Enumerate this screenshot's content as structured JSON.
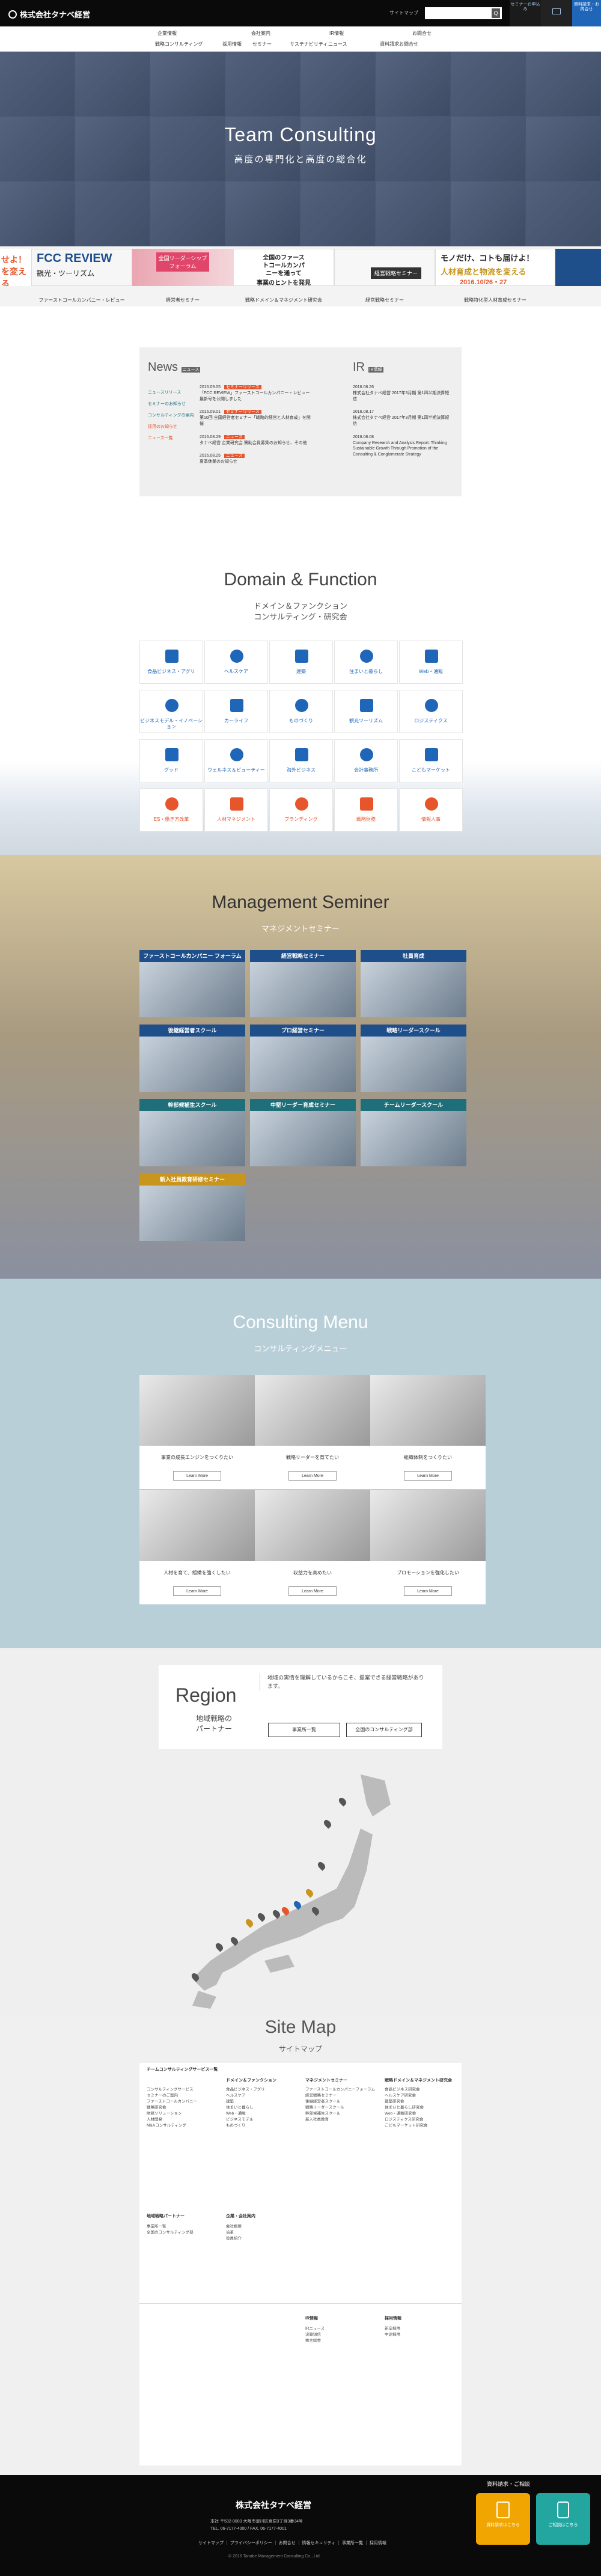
{
  "header": {
    "logo": "株式会社タナベ経営",
    "sitemap": "サイトマップ",
    "search_placeholder": "",
    "search_btn": "Q",
    "btn1": "セミナーお申込み",
    "btn2": "",
    "btn3": "資料請求・お問合せ"
  },
  "nav": {
    "col1": {
      "title": "企業情報",
      "items": [
        "戦略コンサルティング",
        "採用情報",
        "サステナビリティ"
      ]
    },
    "col2": {
      "title": "会社案内",
      "items": [
        "採用",
        "セミナー"
      ]
    },
    "col3": {
      "title": "IR情報",
      "items": [
        "ニュース",
        "ホールディングス"
      ]
    },
    "col4": {
      "title": "お問合せ",
      "items": [
        "資料請求お問合せ",
        "ダウンロード"
      ]
    }
  },
  "hero": {
    "title": "Team Consulting",
    "subtitle": "高度の専門化と高度の総合化"
  },
  "banners": [
    {
      "caption": "ファーストコールカンパニー・レビュー",
      "big": "FCC REVIEW",
      "sub": "観光・ツーリズム"
    },
    {
      "caption": "経営者セミナー",
      "big": "全国リーダーシップフォーラム"
    },
    {
      "caption": "戦略ドメイン＆マネジメント研究会",
      "big": "全国のファーストコールカンパニーを通って",
      "sub": "事業のヒントを発見"
    },
    {
      "caption": "経営戦略セミナー",
      "big": "経営戦略セミナー"
    },
    {
      "caption": "戦略特化型人材育成セミナー",
      "big": "モノだけ、コトも届けよ！",
      "sub": "人材育成と物流を変える",
      "date": "2016.10/26・27"
    }
  ],
  "news": {
    "title": "News",
    "tag": "ニュース",
    "ir_title": "IR",
    "ir_tag": "IR情報",
    "cats": [
      "ニュースリリース",
      "セミナーのお知らせ",
      "コンサルティングの案内",
      "採用のお知らせ",
      "ニュース一覧"
    ],
    "items": [
      {
        "date": "2016.09.05",
        "cat": "セミナーリリース",
        "text": "「FCC REVIEW」ファーストコールカンパニー・レビュー 最新号を公開しました"
      },
      {
        "date": "2016.09.01",
        "cat": "セミナーリリース",
        "text": "第10回 全国経営者セミナー「戦略的経営と人材育成」を開催"
      },
      {
        "date": "2016.08.29",
        "cat": "ニュース",
        "text": "タナベ経営 企業研究会 賛助会員募集のお知らせ、その他"
      },
      {
        "date": "2016.08.25",
        "cat": "ニュース",
        "text": "夏季休業のお知らせ"
      }
    ],
    "ir": [
      {
        "date": "2016.08.26",
        "text": "株式会社タナベ経営 2017年3月期 第1四半期決算短信"
      },
      {
        "date": "2016.08.17",
        "text": "株式会社タナベ経営 2017年3月期 第1四半期決算短信"
      },
      {
        "date": "2016.08.08",
        "text": "Company Research and Analysis Report: Thinking Sustainable Growth Through Promotion of the Consulting & Conglomerate Strategy"
      }
    ]
  },
  "domain": {
    "title": "Domain & Function",
    "sub1": "ドメイン＆ファンクション",
    "sub2": "コンサルティング・研究会",
    "cells": [
      "食品ビジネス・アグリ",
      "ヘルスケア",
      "建築",
      "住まいと暮らし",
      "Web・通販",
      "ビジネスモデル・イノベーション",
      "カーライフ",
      "ものづくり",
      "観光ツーリズム",
      "ロジスティクス",
      "グッド",
      "ウェルネス＆ビューティー",
      "海外ビジネス",
      "会計事務所",
      "こどもマーケット",
      "ES・働き方改革",
      "人材マネジメント",
      "ブランディング",
      "戦略財務",
      "情報人事"
    ]
  },
  "seminar": {
    "title": "Management Seminer",
    "sub": "マネジメントセミナー",
    "cards": [
      {
        "title": "ファーストコールカンパニー フォーラム",
        "color": "#1f4f8a"
      },
      {
        "title": "経営戦略セミナー",
        "color": "#1f4f8a"
      },
      {
        "title": "社員育成",
        "color": "#1f4f8a"
      },
      {
        "title": "後継経営者スクール",
        "color": "#1f4f8a"
      },
      {
        "title": "プロ経営セミナー",
        "color": "#1f4f8a"
      },
      {
        "title": "戦略リーダースクール",
        "color": "#1f4f8a"
      },
      {
        "title": "幹部候補生スクール",
        "color": "#1f6f7a"
      },
      {
        "title": "中堅リーダー育成セミナー",
        "color": "#1f6f7a"
      },
      {
        "title": "チームリーダースクール",
        "color": "#1f6f7a"
      },
      {
        "title": "新入社員教育研修セミナー",
        "color": "#c8961e"
      }
    ]
  },
  "consulting": {
    "title": "Consulting Menu",
    "sub": "コンサルティングメニュー",
    "btn": "Learn More",
    "cards": [
      "事業の成長エンジンをつくりたい",
      "戦略リーダーを育てたい",
      "組織体制をつくりたい",
      "人材を育て、組織を強くしたい",
      "収益力を高めたい",
      "プロモーションを強化したい"
    ]
  },
  "region": {
    "title": "Region",
    "sub": "地域戦略のパートナー",
    "text": "地域の実情を理解しているからこそ、提案できる経営戦略があります。",
    "btn1": "事業所一覧",
    "btn2": "全国のコンサルティング部"
  },
  "sitemap": {
    "title": "Site Map",
    "sub": "サイトマップ",
    "cols": [
      {
        "head": "チームコンサルティングサービス一覧",
        "items": [
          "コンサルティングサービス",
          "セミナーのご案内",
          "ファーストコールカンパニー",
          "戦略研究会",
          "財務ソリューション",
          "人材開発",
          "M&Aコンサルティング"
        ]
      },
      {
        "head": "ドメイン＆ファンクション",
        "items": [
          "食品ビジネス・アグリ",
          "ヘルスケア",
          "建築",
          "住まいと暮らし",
          "Web・通販",
          "ビジネスモデル",
          "ものづくり"
        ]
      },
      {
        "head": "マネジメントセミナー",
        "items": [
          "ファーストコールカンパニーフォーラム",
          "経営戦略セミナー",
          "後継経営者スクール",
          "戦略リーダースクール",
          "幹部候補生スクール",
          "新入社員教育"
        ]
      },
      {
        "head": "戦略ドメイン＆マネジメント研究会",
        "items": [
          "食品ビジネス研究会",
          "ヘルスケア研究会",
          "建築研究会",
          "住まいと暮らし研究会",
          "Web・通販研究会",
          "ロジスティクス研究会",
          "こどもマーケット研究会"
        ]
      }
    ],
    "bottom": [
      {
        "head": "地域戦略パートナー",
        "items": [
          "事業所一覧",
          "全国のコンサルティング部"
        ]
      },
      {
        "head": "企業・会社案内",
        "items": [
          "会社概要",
          "沿革",
          "役員紹介"
        ]
      },
      {
        "head": "IR情報",
        "items": [
          "IRニュース",
          "決算短信",
          "株主総会"
        ]
      },
      {
        "head": "採用情報",
        "items": [
          "新卒採用",
          "中途採用"
        ]
      }
    ]
  },
  "footer": {
    "logo": "株式会社タナベ経営",
    "addr": "本社 〒532-0003 大阪市淀川区宮原3丁目3番34号",
    "tel": "TEL. 06-7177-4000 / FAX. 06-7177-4001",
    "links": "サイトマップ ｜ プライバシーポリシー ｜ お問合せ ｜ 情報セキュリティ ｜ 事業所一覧 ｜ 採用情報",
    "copy": "© 2016 Tanabe Management Consulting Co., Ltd.",
    "contact": "資料請求・ご相談",
    "btn1": "資料請求はこちら",
    "btn2": "ご相談はこちら"
  },
  "colors": {
    "accent": "#e7552c",
    "navy": "#1f4f8a",
    "teal": "#1f6f7a",
    "gold": "#c8961e"
  }
}
